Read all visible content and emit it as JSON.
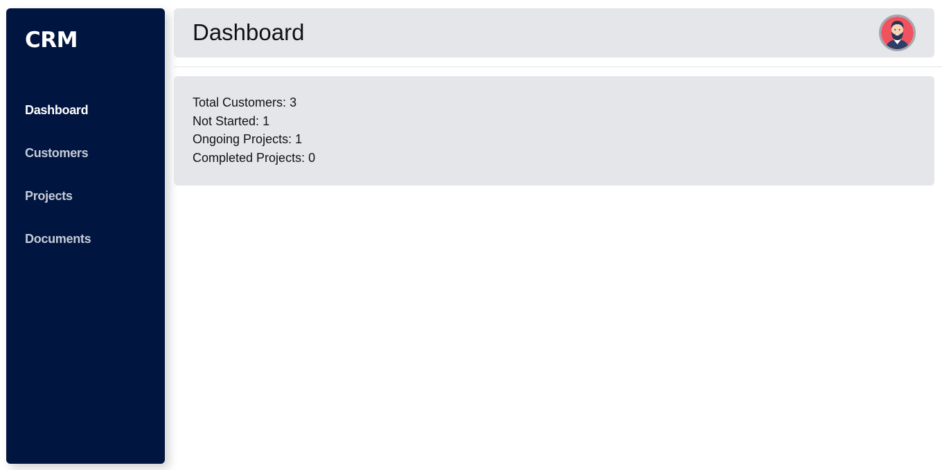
{
  "sidebar": {
    "brand": "CRM",
    "items": [
      {
        "label": "Dashboard",
        "active": true
      },
      {
        "label": "Customers",
        "active": false
      },
      {
        "label": "Projects",
        "active": false
      },
      {
        "label": "Documents",
        "active": false
      }
    ]
  },
  "header": {
    "title": "Dashboard",
    "avatar_icon": "user-avatar-bearded-man"
  },
  "stats": {
    "total_customers": {
      "label": "Total Customers:",
      "value": "3"
    },
    "not_started": {
      "label": "Not Started:",
      "value": "1"
    },
    "ongoing_projects": {
      "label": "Ongoing Projects:",
      "value": "1"
    },
    "completed_projects": {
      "label": "Completed Projects:",
      "value": "0"
    }
  },
  "colors": {
    "sidebar_bg": "#00153f",
    "panel_bg": "#e5e6ea",
    "nav_active": "#ffffff",
    "nav_inactive": "#c7cbd6",
    "avatar_bg": "#f0525f"
  }
}
